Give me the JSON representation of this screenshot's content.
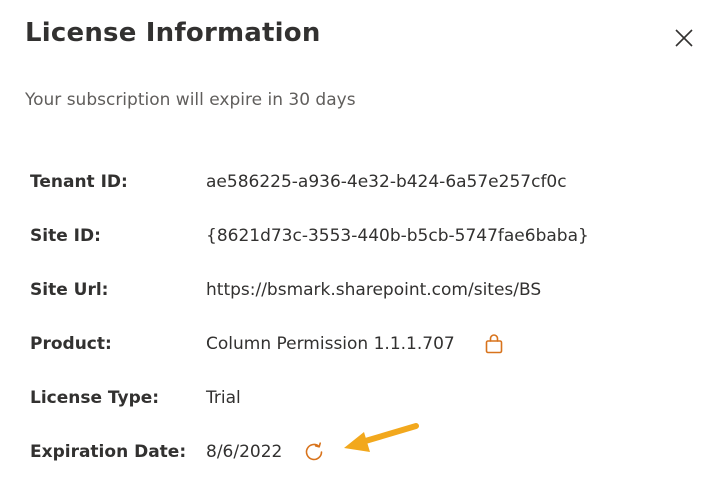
{
  "dialog": {
    "title": "License Information",
    "subtitle": "Your subscription will expire in 30 days"
  },
  "fields": [
    {
      "label": "Tenant ID:",
      "value": "ae586225-a936-4e32-b424-6a57e257cf0c"
    },
    {
      "label": "Site ID:",
      "value": "{8621d73c-3553-440b-b5cb-5747fae6baba}"
    },
    {
      "label": "Site Url:",
      "value": "https://bsmark.sharepoint.com/sites/BS"
    },
    {
      "label": "Product:",
      "value": "Column Permission 1.1.1.707"
    },
    {
      "label": "License Type:",
      "value": "Trial"
    },
    {
      "label": "Expiration Date:",
      "value": "8/6/2022"
    }
  ],
  "icons": {
    "close": "close-icon",
    "buy": "shopping-bag-icon",
    "refresh": "refresh-icon",
    "arrow": "arrow-pointer"
  },
  "colors": {
    "accent": "#d8731c",
    "arrow": "#f2a81d",
    "text": "#323130",
    "muted": "#605e5c"
  }
}
